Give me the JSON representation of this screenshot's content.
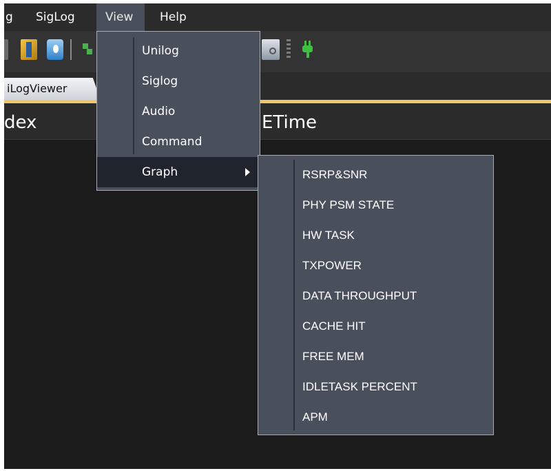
{
  "menubar": {
    "items": [
      {
        "label": "g"
      },
      {
        "label": "SigLog"
      },
      {
        "label": "View"
      },
      {
        "label": "Help"
      }
    ]
  },
  "toolbar": {
    "icons": [
      "log-file-icon",
      "archive-icon",
      "database-help-icon",
      "filter-icon",
      "search-document-icon",
      "plug-icon"
    ],
    "accent_green": "#3fbf3f"
  },
  "tabs": [
    {
      "label": "iLogViewer"
    }
  ],
  "list": {
    "columns": [
      {
        "label": "dex"
      },
      {
        "label": "ETime"
      }
    ]
  },
  "view_menu": {
    "items": [
      {
        "label": "Unilog"
      },
      {
        "label": "Siglog"
      },
      {
        "label": "Audio"
      },
      {
        "label": "Command"
      },
      {
        "label": "Graph"
      }
    ]
  },
  "graph_menu": {
    "items": [
      {
        "label": "RSRP&SNR"
      },
      {
        "label": "PHY PSM STATE"
      },
      {
        "label": "HW TASK"
      },
      {
        "label": "TXPOWER"
      },
      {
        "label": "DATA THROUGHPUT"
      },
      {
        "label": "CACHE HIT"
      },
      {
        "label": "FREE MEM"
      },
      {
        "label": "IDLETASK PERCENT"
      },
      {
        "label": "APM"
      }
    ]
  },
  "colors": {
    "menu_bg": "#4a4f5c",
    "menu_highlight": "#20242c",
    "tab_accent": "#f0c76a",
    "app_bg": "#1e1e1e"
  }
}
